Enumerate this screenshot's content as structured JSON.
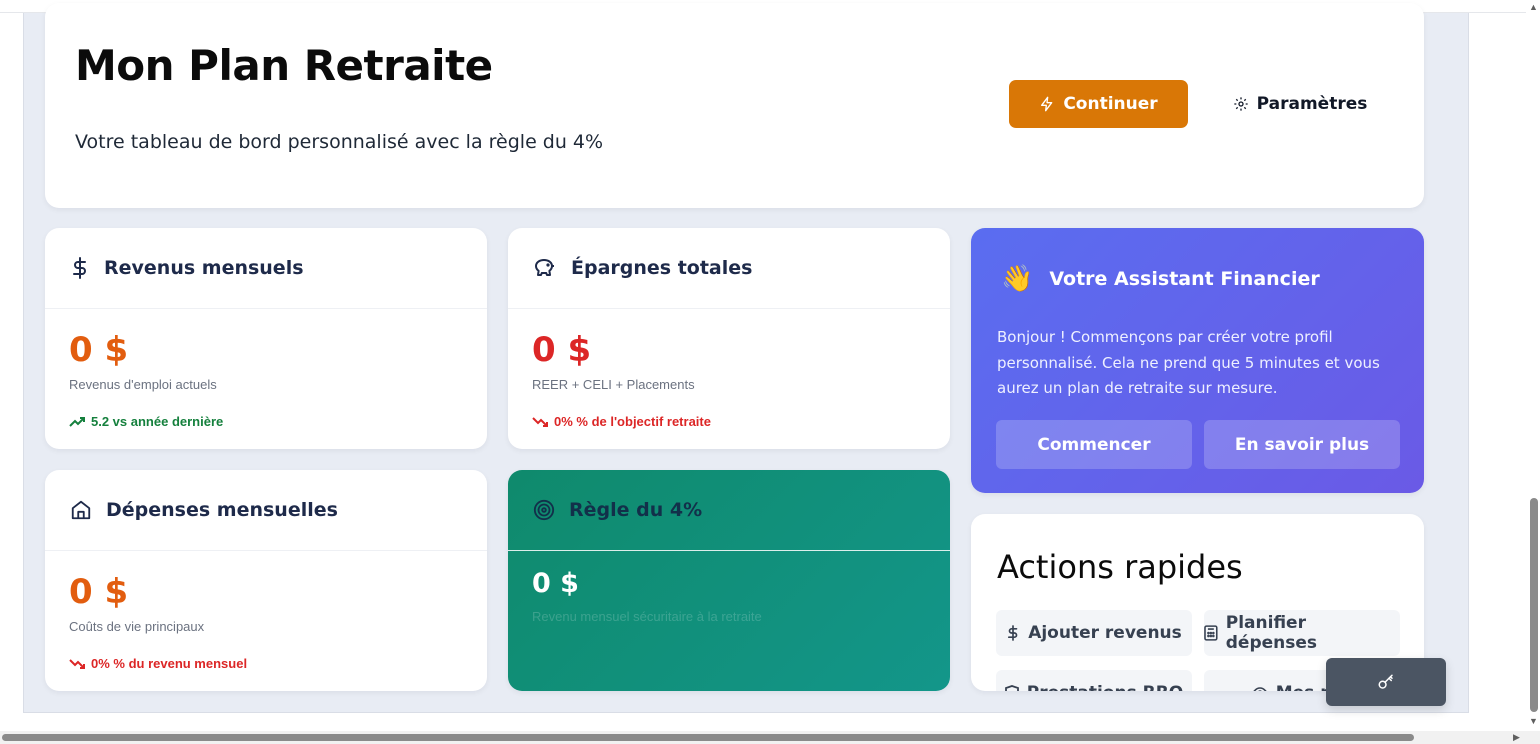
{
  "header": {
    "title": "Mon Plan Retraite",
    "subtitle": "Votre tableau de bord personnalisé avec la règle du 4%",
    "continue_label": "Continuer",
    "settings_label": "Paramètres"
  },
  "stats": {
    "income": {
      "title": "Revenus mensuels",
      "value": "0 $",
      "description": "Revenus d'emploi actuels",
      "trend": "5.2 vs année dernière"
    },
    "savings": {
      "title": "Épargnes totales",
      "value": "0 $",
      "description": "REER + CELI + Placements",
      "trend": "0% % de l'objectif retraite"
    },
    "expenses": {
      "title": "Dépenses mensuelles",
      "value": "0 $",
      "description": "Coûts de vie principaux",
      "trend": "0% % du revenu mensuel"
    },
    "rule": {
      "title": "Règle du 4%",
      "value": "0 $",
      "description": "Revenu mensuel sécuritaire à la retraite"
    }
  },
  "assistant": {
    "emoji": "👋",
    "title": "Votre Assistant Financier",
    "text": "Bonjour ! Commençons par créer votre profil personnalisé. Cela ne prend que 5 minutes et vous aurez un plan de retraite sur mesure.",
    "start_label": "Commencer",
    "learn_label": "En savoir plus"
  },
  "quick_actions": {
    "title": "Actions rapides",
    "items": [
      {
        "label": "Ajouter revenus",
        "icon": "dollar-icon"
      },
      {
        "label": "Planifier dépenses",
        "icon": "calculator-icon"
      },
      {
        "label": "Prestations RRQ",
        "icon": "shield-icon"
      },
      {
        "label": "Mes rap",
        "icon": "eye-icon"
      }
    ]
  },
  "colors": {
    "accent_orange": "#d97706",
    "value_orange": "#e25d0f",
    "value_red": "#dc2626",
    "assistant_bg": "#5a6df0",
    "rule_bg": "#0f8a6c"
  }
}
